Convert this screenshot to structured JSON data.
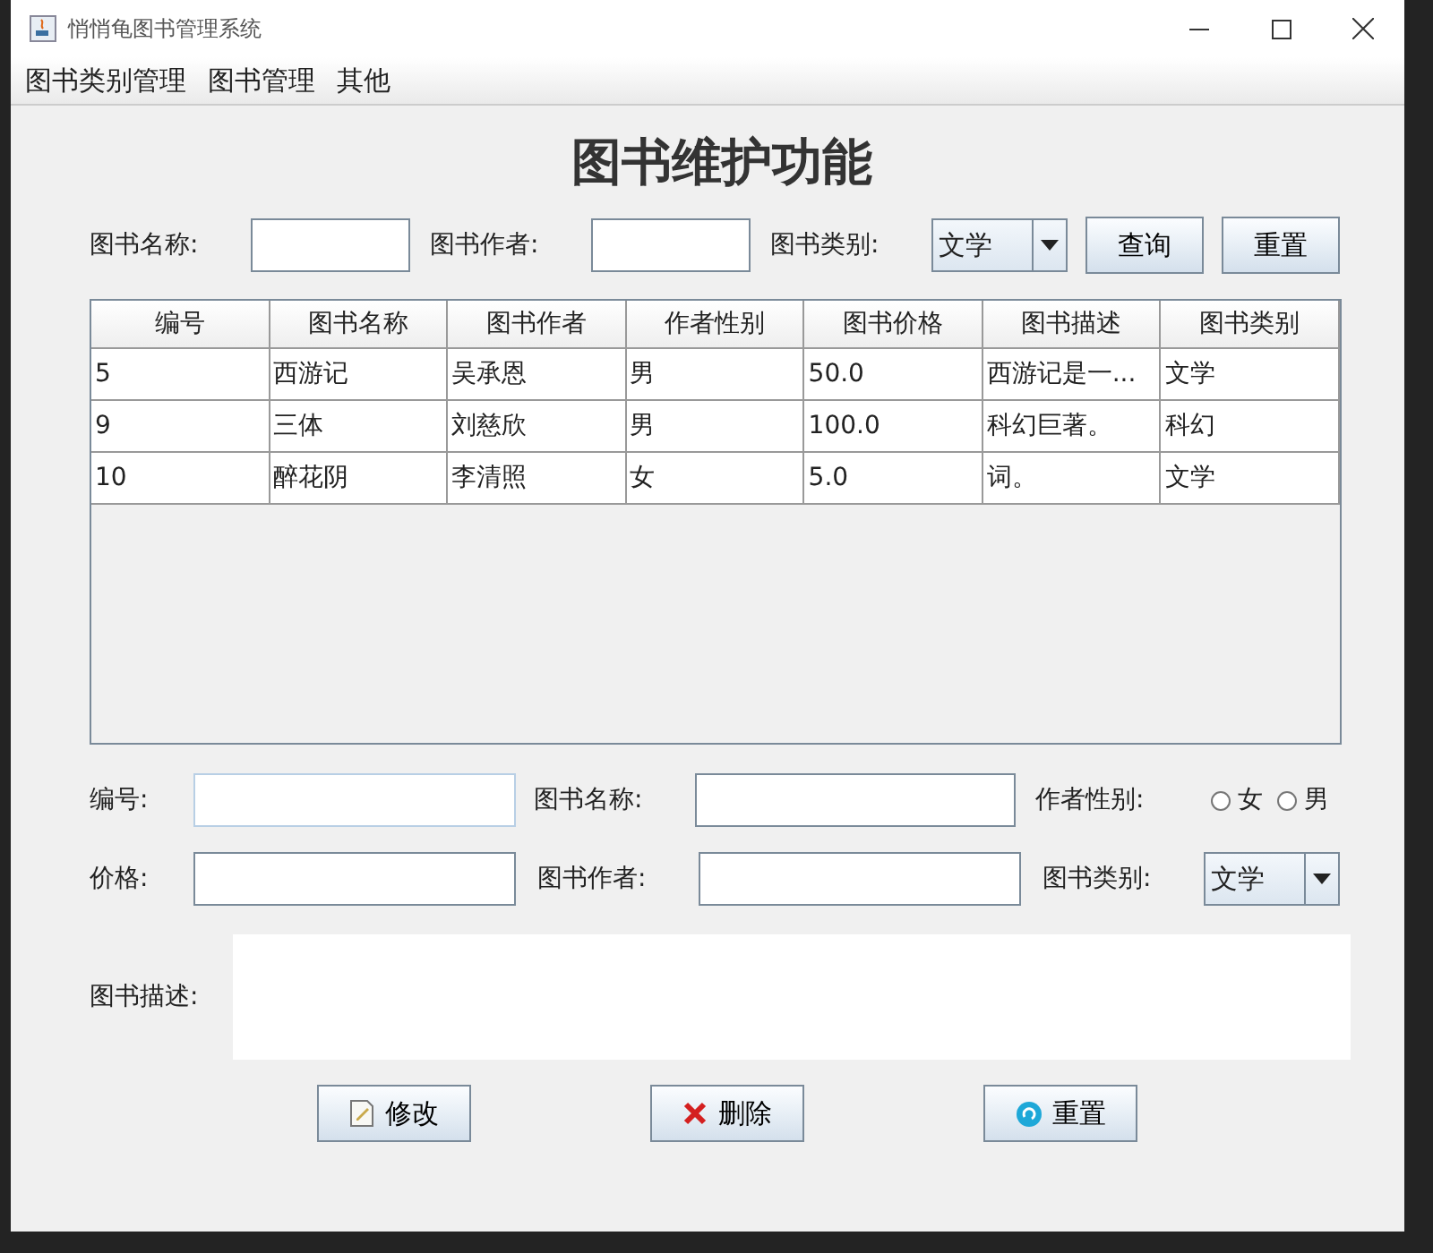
{
  "window": {
    "title": "悄悄龟图书管理系统"
  },
  "menu": [
    "图书类别管理",
    "图书管理",
    "其他"
  ],
  "heading": "图书维护功能",
  "search": {
    "name_label": "图书名称:",
    "author_label": "图书作者:",
    "category_label": "图书类别:",
    "category_value": "文学",
    "buttons": [
      "查询",
      "重置"
    ]
  },
  "table": {
    "columns": [
      "编号",
      "图书名称",
      "图书作者",
      "作者性别",
      "图书价格",
      "图书描述",
      "图书类别"
    ],
    "rows": [
      [
        "5",
        "西游记",
        "吴承恩",
        "男",
        "50.0",
        "西游记是一...",
        "文学"
      ],
      [
        "9",
        "三体",
        "刘慈欣",
        "男",
        "100.0",
        "科幻巨著。",
        "科幻"
      ],
      [
        "10",
        "醉花阴",
        "李清照",
        "女",
        "5.0",
        "词。",
        "文学"
      ]
    ]
  },
  "form": {
    "id_label": "编号:",
    "name_label": "图书名称:",
    "gender_label": "作者性别:",
    "genders": [
      {
        "label": "女",
        "selected": false
      },
      {
        "label": "男",
        "selected": false
      }
    ],
    "price_label": "价格:",
    "author_label": "图书作者:",
    "category_label": "图书类别:",
    "category_value": "文学",
    "description_label": "图书描述:"
  },
  "actions": [
    {
      "kind": "edit",
      "label": "修改"
    },
    {
      "kind": "delete",
      "label": "删除"
    },
    {
      "kind": "reset",
      "label": "重置"
    }
  ]
}
